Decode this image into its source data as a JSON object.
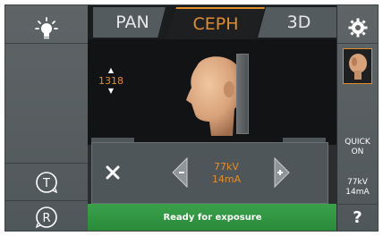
{
  "tabs": [
    {
      "label": "PAN",
      "active": false
    },
    {
      "label": "CEPH",
      "active": true
    },
    {
      "label": "3D",
      "active": false
    }
  ],
  "preview": {
    "counter_value": "1318"
  },
  "exposure": {
    "kv": "77kV",
    "ma": "14mA"
  },
  "quick": {
    "line1": "QUICK",
    "line2": "ON",
    "kv": "77kV",
    "ma": "14mA"
  },
  "left_panel": {
    "t_button": "T",
    "r_button": "R"
  },
  "status_text": "Ready for exposure",
  "help_label": "?",
  "icons": {
    "light": "light-bulb-icon",
    "settings": "gear-icon",
    "close": "close-x-icon",
    "minus": "minus-arrow-icon",
    "plus": "plus-arrow-icon",
    "t_rotate": "t-rotate-icon",
    "r_rotate": "r-rotate-icon"
  },
  "colors": {
    "accent_orange": "#e08e2c",
    "status_green": "#2f9a40",
    "panel_gray": "#555c5f",
    "preview_black": "#111314"
  }
}
